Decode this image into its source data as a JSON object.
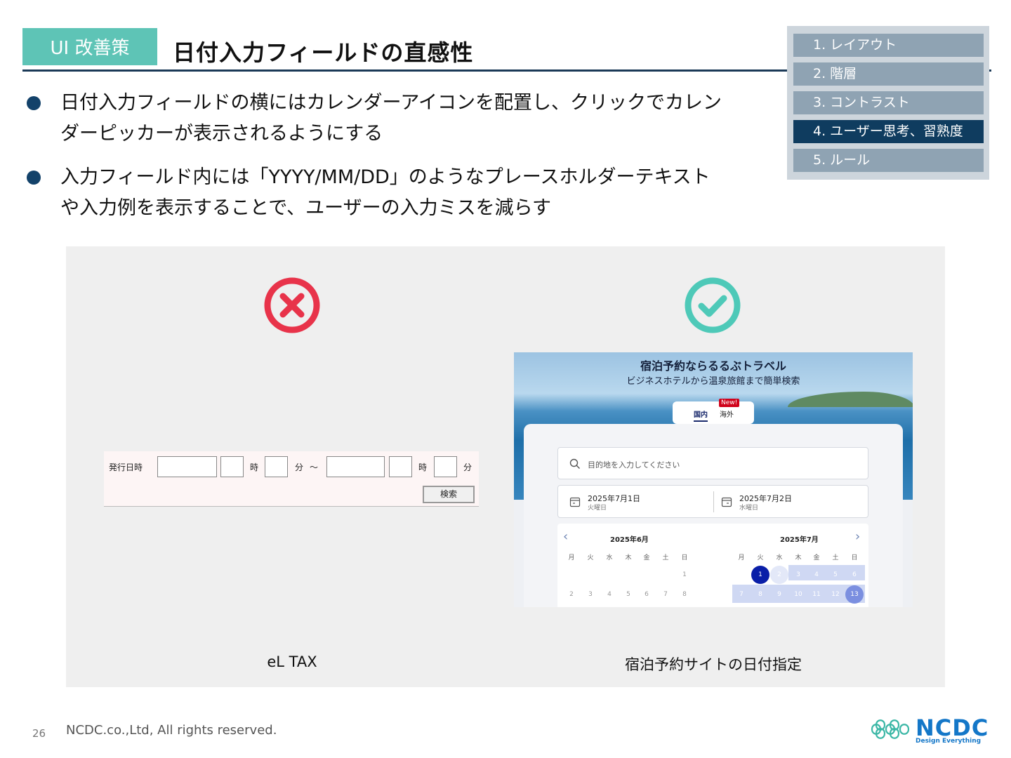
{
  "header": {
    "tag": "UI 改善策",
    "title": "日付入力フィールドの直感性"
  },
  "index": {
    "items": [
      {
        "label": "1. レイアウト",
        "active": false
      },
      {
        "label": "2. 階層",
        "active": false
      },
      {
        "label": "3. コントラスト",
        "active": false
      },
      {
        "label": "4. ユーザー思考、習熟度",
        "active": true
      },
      {
        "label": "5. ルール",
        "active": false
      }
    ]
  },
  "bullets": [
    {
      "line1": "日付入力フィールドの横にはカレンダーアイコンを配置し、クリックでカレン",
      "line2": "ダーピッカーが表示されるようにする"
    },
    {
      "line1": "入力フィールド内には「YYYY/MM/DD」のようなプレースホルダーテキスト",
      "line2": "や入力例を表示することで、ユーザーの入力ミスを減らす"
    }
  ],
  "examples": {
    "bad": {
      "icon": "x-circle-icon",
      "caption": "eL TAX",
      "form": {
        "label": "発行日時",
        "hour": "時",
        "minute": "分",
        "tilde": "～",
        "search_button": "検索"
      }
    },
    "good": {
      "icon": "check-circle-icon",
      "caption": "宿泊予約サイトの日付指定",
      "site": {
        "title": "宿泊予約ならるるぶトラベル",
        "subtitle": "ビジネスホテルから温泉旅館まで簡単検索",
        "tab_domestic": "国内",
        "tab_overseas": "海外",
        "new_badge": "New!",
        "search_placeholder": "目的地を入力してください",
        "checkin": {
          "date": "2025年7月1日",
          "weekday": "火曜日"
        },
        "checkout": {
          "date": "2025年7月2日",
          "weekday": "水曜日"
        },
        "calendar": {
          "left_month": "2025年6月",
          "right_month": "2025年7月",
          "weekdays": [
            "月",
            "火",
            "水",
            "木",
            "金",
            "土",
            "日"
          ],
          "left_days_row1": [
            "1"
          ],
          "left_days_row2": [
            "2",
            "3",
            "4",
            "5",
            "6",
            "7",
            "8"
          ],
          "right_days_row1": [
            "1",
            "2",
            "3",
            "4",
            "5",
            "6"
          ],
          "right_days_row2": [
            "7",
            "8",
            "9",
            "10",
            "11",
            "12",
            "13"
          ]
        }
      }
    }
  },
  "colors": {
    "accent": "#5ec4b6",
    "navy": "#0f3c5f",
    "bad": "#e8334a",
    "good": "#4ec9b8"
  },
  "footer": {
    "page": "26",
    "copyright": "NCDC.co.,Ltd, All rights reserved.",
    "logo": "NCDC",
    "logo_tagline": "Design Everything"
  }
}
